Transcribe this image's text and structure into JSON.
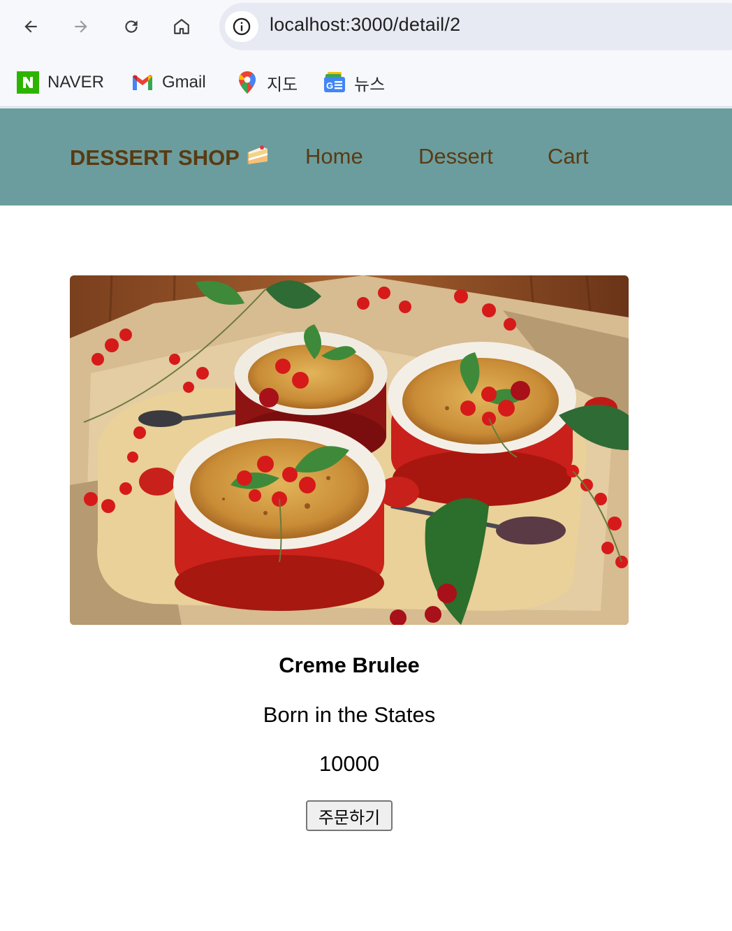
{
  "browser": {
    "url": "localhost:3000/detail/2",
    "bookmarks": [
      {
        "label": "NAVER",
        "icon": "naver-icon"
      },
      {
        "label": "Gmail",
        "icon": "gmail-icon"
      },
      {
        "label": "지도",
        "icon": "maps-icon"
      },
      {
        "label": "뉴스",
        "icon": "news-icon"
      }
    ]
  },
  "navbar": {
    "brand": "DESSERT SHOP",
    "brand_icon": "cake-icon",
    "links": [
      "Home",
      "Dessert",
      "Cart"
    ],
    "background": "#6b9d9e",
    "text_color": "#5a3a12"
  },
  "product": {
    "image_subject": "creme-brulee-photo",
    "title": "Creme Brulee",
    "description": "Born in the States",
    "price": "10000",
    "order_button": "주문하기"
  }
}
